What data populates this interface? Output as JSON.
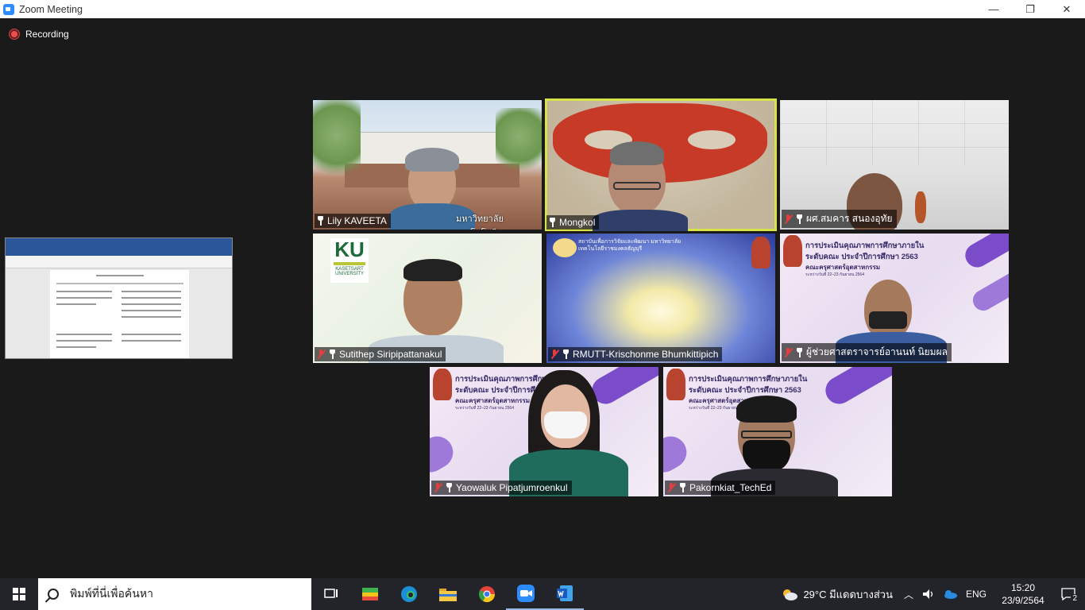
{
  "window": {
    "title": "Zoom Meeting",
    "minimize": "—",
    "restore": "❐",
    "close": "✕"
  },
  "recording": {
    "label": "Recording"
  },
  "participants": [
    {
      "name": "Lily KAVEETA",
      "muted": false,
      "active": false,
      "overlay_text": "มหาวิทยาลัยเทคโนโลยีราชมงคลสุวรรณภูมิ"
    },
    {
      "name": "Mongkol",
      "muted": false,
      "active": true
    },
    {
      "name": "ผศ.สมคาร  สนองอุทัย",
      "muted": true,
      "active": false
    },
    {
      "name": "Sutithep Siripipattanakul",
      "muted": true,
      "active": false,
      "logo": {
        "mark": "KU",
        "line1": "KASETSART",
        "line2": "UNIVERSITY"
      }
    },
    {
      "name": "RMUTT-Krischonme Bhumkittipich",
      "muted": true,
      "active": false
    },
    {
      "name": "ผู้ช่วยศาสตราจารย์อานนท์ นิยมผล",
      "muted": true,
      "active": false,
      "slide": {
        "title1": "การประเมินคุณภาพการศึกษาภายใน",
        "title2": "ระดับคณะ ประจำปีการศึกษา 2563",
        "faculty": "คณะครุศาสตร์อุตสาหกรรม",
        "date": "ระหว่างวันที่ 22–23 กันยายน 2564"
      }
    },
    {
      "name": "Yaowaluk Pipatjumroenkul",
      "muted": true,
      "active": false,
      "slide": {
        "title1": "การประเมินคุณภาพการศึกษาภายใน",
        "title2": "ระดับคณะ ประจำปีการศึกษา 2563",
        "faculty": "คณะครุศาสตร์อุตสาหกรรม",
        "date": "ระหว่างวันที่ 22–23 กันยายน 2564"
      }
    },
    {
      "name": "Pakornkiat_TechEd",
      "muted": true,
      "active": false,
      "slide": {
        "title1": "การประเมินคุณภาพการศึกษาภายใน",
        "title2": "ระดับคณะ ประจำปีการศึกษา 2563",
        "faculty": "คณะครุศาสตร์อุตสาหกรรม",
        "date": "ระหว่างวันที่ 22–23 กันยายน 2564"
      }
    }
  ],
  "rmutt_banner": "สถาบันเพื่อการวิจัยและพัฒนา มหาวิทยาลัยเทคโนโลยีราชมงคลธัญบุรี",
  "taskbar": {
    "search_placeholder": "พิมพ์ที่นี่เพื่อค้นหา",
    "weather": "29°C  มีแดดบางส่วน",
    "language": "ENG",
    "time": "15:20",
    "date": "23/9/2564",
    "notification_count": "2"
  },
  "colors": {
    "active_speaker": "#d8e34a",
    "mute_red": "#e53e3e",
    "taskbar": "#23242a"
  }
}
